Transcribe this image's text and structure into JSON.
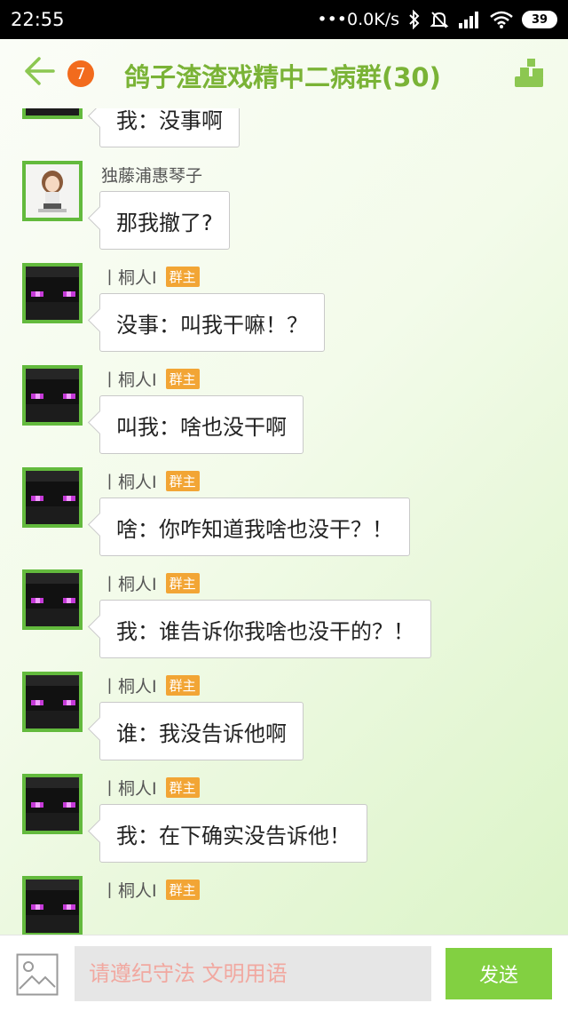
{
  "status": {
    "time": "22:55",
    "network_speed": "•••0.0K/s",
    "battery": "39"
  },
  "header": {
    "unread_count": "7",
    "title": "鸽子渣渣戏精中二病群(30)",
    "back_icon": "back-arrow-icon",
    "members_icon": "group-members-icon"
  },
  "owner_badge": "群主",
  "messages": [
    {
      "sender": "丨桐人I",
      "owner": true,
      "text": "我：没事啊",
      "avatar": "enderman"
    },
    {
      "sender": "独藤浦惠琴子",
      "owner": false,
      "text": "那我撤了?",
      "avatar": "girl"
    },
    {
      "sender": "丨桐人I",
      "owner": true,
      "text": "没事：叫我干嘛！？",
      "avatar": "enderman"
    },
    {
      "sender": "丨桐人I",
      "owner": true,
      "text": "叫我：啥也没干啊",
      "avatar": "enderman"
    },
    {
      "sender": "丨桐人I",
      "owner": true,
      "text": "啥：你咋知道我啥也没干？！",
      "avatar": "enderman"
    },
    {
      "sender": "丨桐人I",
      "owner": true,
      "text": "我：谁告诉你我啥也没干的？！",
      "avatar": "enderman"
    },
    {
      "sender": "丨桐人I",
      "owner": true,
      "text": "谁：我没告诉他啊",
      "avatar": "enderman"
    },
    {
      "sender": "丨桐人I",
      "owner": true,
      "text": "我：在下确实没告诉他！",
      "avatar": "enderman"
    },
    {
      "sender": "丨桐人I",
      "owner": true,
      "text": "",
      "avatar": "enderman"
    }
  ],
  "input": {
    "placeholder": "请遵纪守法 文明用语",
    "send_label": "发送",
    "image_icon": "image-icon"
  },
  "colors": {
    "accent": "#7ab336",
    "badge": "#f26b1d",
    "owner_badge": "#f2a535",
    "send": "#82d041"
  }
}
